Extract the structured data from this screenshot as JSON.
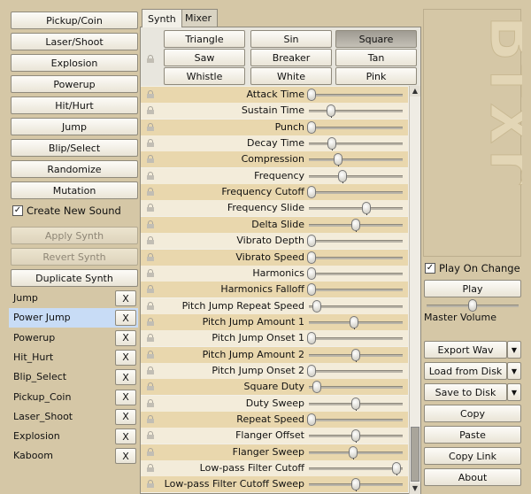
{
  "generators": {
    "pickup": "Pickup/Coin",
    "laser": "Laser/Shoot",
    "explosion": "Explosion",
    "powerup": "Powerup",
    "hit": "Hit/Hurt",
    "jump": "Jump",
    "blip": "Blip/Select",
    "randomize": "Randomize",
    "mutation": "Mutation"
  },
  "create_new_sound": {
    "label": "Create New Sound",
    "checked": true
  },
  "apply_synth": "Apply Synth",
  "revert_synth": "Revert Synth",
  "duplicate_synth": "Duplicate Synth",
  "sounds": [
    {
      "name": "Jump",
      "selected": false
    },
    {
      "name": "Power Jump",
      "selected": true
    },
    {
      "name": "Powerup",
      "selected": false
    },
    {
      "name": "Hit_Hurt",
      "selected": false
    },
    {
      "name": "Blip_Select",
      "selected": false
    },
    {
      "name": "Pickup_Coin",
      "selected": false
    },
    {
      "name": "Laser_Shoot",
      "selected": false
    },
    {
      "name": "Explosion",
      "selected": false
    },
    {
      "name": "Kaboom",
      "selected": false
    }
  ],
  "remove_label": "X",
  "tabs": [
    "Synth",
    "Mixer"
  ],
  "waveforms": [
    "Triangle",
    "Sin",
    "Square",
    "Saw",
    "Breaker",
    "Tan",
    "Whistle",
    "White",
    "Pink"
  ],
  "selected_waveform": "Square",
  "params": [
    {
      "label": "Attack Time",
      "value": 0.0
    },
    {
      "label": "Sustain Time",
      "value": 0.22
    },
    {
      "label": "Punch",
      "value": 0.0
    },
    {
      "label": "Decay Time",
      "value": 0.23
    },
    {
      "label": "Compression",
      "value": 0.3
    },
    {
      "label": "Frequency",
      "value": 0.35
    },
    {
      "label": "Frequency Cutoff",
      "value": 0.0
    },
    {
      "label": "Frequency Slide",
      "value": 0.62
    },
    {
      "label": "Delta Slide",
      "value": 0.5
    },
    {
      "label": "Vibrato Depth",
      "value": 0.0
    },
    {
      "label": "Vibrato Speed",
      "value": 0.0
    },
    {
      "label": "Harmonics",
      "value": 0.0
    },
    {
      "label": "Harmonics Falloff",
      "value": 0.0
    },
    {
      "label": "Pitch Jump Repeat Speed",
      "value": 0.06
    },
    {
      "label": "Pitch Jump Amount 1",
      "value": 0.48
    },
    {
      "label": "Pitch Jump Onset 1",
      "value": 0.0
    },
    {
      "label": "Pitch Jump Amount 2",
      "value": 0.5
    },
    {
      "label": "Pitch Jump Onset 2",
      "value": 0.0
    },
    {
      "label": "Square Duty",
      "value": 0.06
    },
    {
      "label": "Duty Sweep",
      "value": 0.5
    },
    {
      "label": "Repeat Speed",
      "value": 0.0
    },
    {
      "label": "Flanger Offset",
      "value": 0.5
    },
    {
      "label": "Flanger Sweep",
      "value": 0.47
    },
    {
      "label": "Low-pass Filter Cutoff",
      "value": 0.96
    },
    {
      "label": "Low-pass Filter Cutoff Sweep",
      "value": 0.5
    }
  ],
  "play_on_change": {
    "label": "Play On Change",
    "checked": true
  },
  "play": "Play",
  "master_volume": {
    "label": "Master Volume",
    "value": 0.5
  },
  "export_wav": "Export Wav",
  "load_from_disk": "Load from Disk",
  "save_to_disk": "Save to Disk",
  "copy": "Copy",
  "paste": "Paste",
  "copy_link": "Copy Link",
  "about": "About",
  "logo": "Bfxr"
}
